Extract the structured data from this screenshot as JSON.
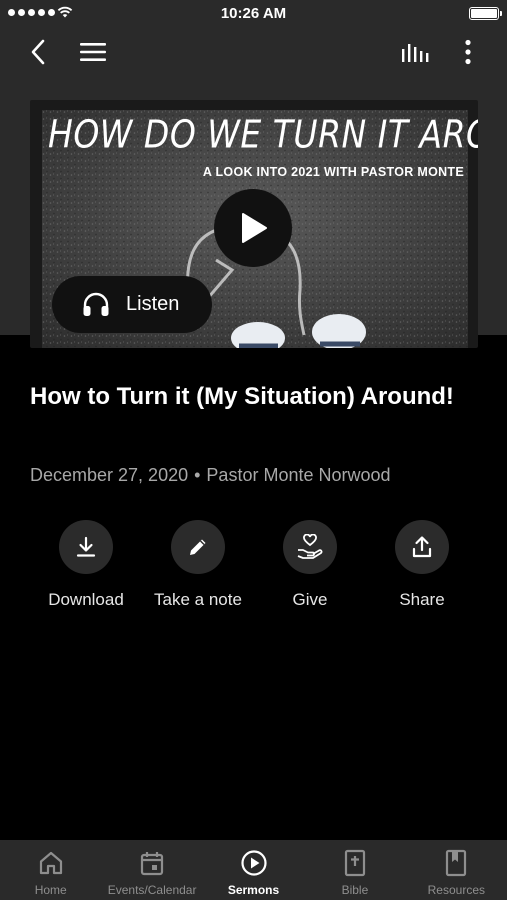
{
  "status_bar": {
    "time": "10:26 AM"
  },
  "media": {
    "artwork_title": "HOW DO WE TURN IT AROUND?",
    "artwork_subtitle": "A LOOK INTO 2021 WITH PASTOR MONTE",
    "listen_label": "Listen"
  },
  "sermon": {
    "title": "How to Turn it (My Situation) Around!",
    "date": "December 27, 2020",
    "separator": "•",
    "speaker": "Pastor Monte Norwood"
  },
  "actions": [
    {
      "label": "Download",
      "icon": "download-icon"
    },
    {
      "label": "Take a note",
      "icon": "pencil-icon"
    },
    {
      "label": "Give",
      "icon": "give-icon"
    },
    {
      "label": "Share",
      "icon": "share-icon"
    }
  ],
  "tabs": [
    {
      "label": "Home",
      "icon": "home-icon",
      "active": false
    },
    {
      "label": "Events/Calendar",
      "icon": "calendar-icon",
      "active": false
    },
    {
      "label": "Sermons",
      "icon": "play-circle-icon",
      "active": true
    },
    {
      "label": "Bible",
      "icon": "bible-icon",
      "active": false
    },
    {
      "label": "Resources",
      "icon": "bookmark-book-icon",
      "active": false
    }
  ],
  "colors": {
    "background": "#000000",
    "header_background": "#2a2a2a",
    "action_circle": "#2b2b2b",
    "meta_text": "#a8a8a8",
    "tab_inactive": "#8e8e8e",
    "tab_active": "#ffffff"
  }
}
